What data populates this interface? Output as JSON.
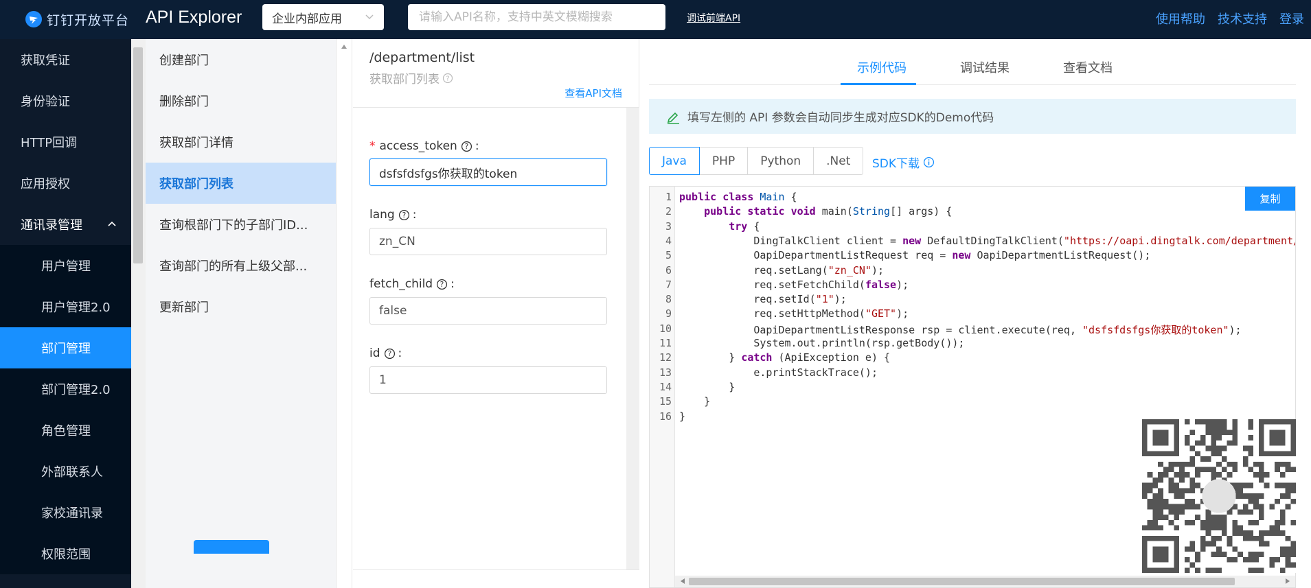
{
  "header": {
    "brand": "钉钉开放平台",
    "title": "API Explorer",
    "app_type": "企业内部应用",
    "search_placeholder": "请输入API名称，支持中英文模糊搜索",
    "frontend_link": "调试前端API",
    "help": "使用帮助",
    "support": "技术支持",
    "login": "登录"
  },
  "leftnav": {
    "items": [
      "获取凭证",
      "身份验证",
      "HTTP回调",
      "应用授权"
    ],
    "group": "通讯录管理",
    "sub_items": [
      "用户管理",
      "用户管理2.0",
      "部门管理",
      "部门管理2.0",
      "角色管理",
      "外部联系人",
      "家校通讯录",
      "权限范围"
    ],
    "active_sub": "部门管理"
  },
  "apilist": {
    "items": [
      "创建部门",
      "删除部门",
      "获取部门详情",
      "获取部门列表",
      "查询根部门下的子部门ID...",
      "查询部门的所有上级父部...",
      "更新部门"
    ],
    "active": "获取部门列表"
  },
  "params": {
    "path": "/department/list",
    "desc": "获取部门列表",
    "doc_link": "查看API文档",
    "fields": [
      {
        "name": "access_token",
        "required": true,
        "value": "dsfsfdsfgs你获取的token"
      },
      {
        "name": "lang",
        "required": false,
        "value": "zn_CN"
      },
      {
        "name": "fetch_child",
        "required": false,
        "value": "false"
      },
      {
        "name": "id",
        "required": false,
        "value": "1"
      }
    ]
  },
  "right": {
    "tabs": [
      "示例代码",
      "调试结果",
      "查看文档"
    ],
    "active_tab": "示例代码",
    "tip": "填写左侧的 API 参数会自动同步生成对应SDK的Demo代码",
    "langs": [
      "Java",
      "PHP",
      "Python",
      ".Net"
    ],
    "active_lang": "Java",
    "sdk_download": "SDK下载",
    "copy": "复制",
    "line_numbers": [
      "1",
      "2",
      "3",
      "4",
      "5",
      "6",
      "7",
      "8",
      "9",
      "10",
      "11",
      "12",
      "13",
      "14",
      "15",
      "16"
    ],
    "code": [
      "public class Main {",
      "    public static void main(String[] args) {",
      "        try {",
      "            DingTalkClient client = new DefaultDingTalkClient(\"https://oapi.dingtalk.com/department/list\");",
      "            OapiDepartmentListRequest req = new OapiDepartmentListRequest();",
      "            req.setLang(\"zn_CN\");",
      "            req.setFetchChild(false);",
      "            req.setId(\"1\");",
      "            req.setHttpMethod(\"GET\");",
      "            OapiDepartmentListResponse rsp = client.execute(req, \"dsfsfdsfgs你获取的token\");",
      "            System.out.println(rsp.getBody());",
      "        } catch (ApiException e) {",
      "            e.printStackTrace();",
      "        }",
      "    }",
      "}"
    ]
  },
  "colors": {
    "topbar": "#0b1e35",
    "nav": "#0d1a2b",
    "accent": "#1890ff",
    "active_api_bg": "#c9e0fb"
  }
}
